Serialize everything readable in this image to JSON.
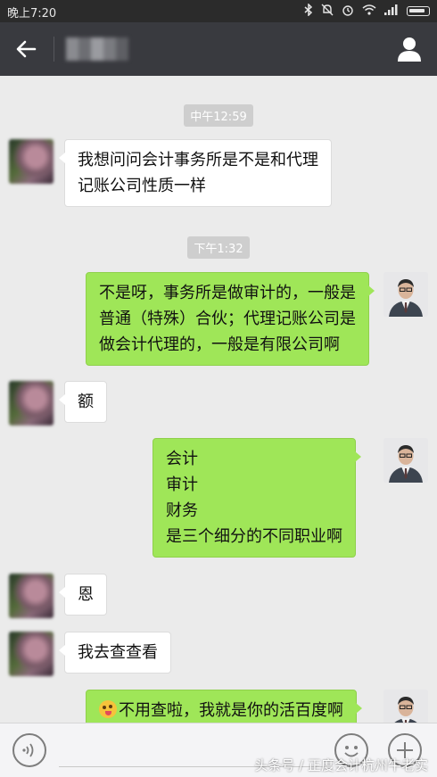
{
  "status_bar": {
    "time": "晚上7:20",
    "icons": [
      "bluetooth-icon",
      "mute-icon",
      "alarm-icon",
      "wifi-icon",
      "signal-icon",
      "battery-icon"
    ]
  },
  "header": {
    "contact_name": "张",
    "colors": {
      "background": "#393a3f",
      "status_bar": "#2b2b2b"
    }
  },
  "chat": {
    "timestamps": [
      "中午12:59",
      "下午1:32"
    ],
    "messages": [
      {
        "side": "left",
        "lines": [
          "我想问问会计事务所是不是和代理",
          "记账公司性质一样"
        ]
      },
      {
        "side": "right",
        "lines": [
          "不是呀，事务所是做审计的，一般是",
          "普通（特殊）合伙；代理记账公司是",
          "做会计代理的，一般是有限公司啊"
        ]
      },
      {
        "side": "left",
        "lines": [
          "额"
        ]
      },
      {
        "side": "right",
        "lines": [
          "会计",
          "审计",
          "财务",
          "是三个细分的不同职业啊"
        ]
      },
      {
        "side": "left",
        "lines": [
          "恩"
        ]
      },
      {
        "side": "left",
        "lines": [
          "我去查查看"
        ]
      },
      {
        "side": "right",
        "emoji": "tongue-emoji",
        "lines": [
          "不用查啦，我就是你的活百度啊"
        ]
      }
    ],
    "colors": {
      "background": "#ebebeb",
      "sent_bubble": "#9fe658",
      "received_bubble": "#ffffff"
    }
  },
  "input_bar": {
    "icons": [
      "voice-icon",
      "emoji-icon",
      "plus-icon"
    ]
  },
  "watermark": "头条号 / 正度会计杭州牛老实"
}
